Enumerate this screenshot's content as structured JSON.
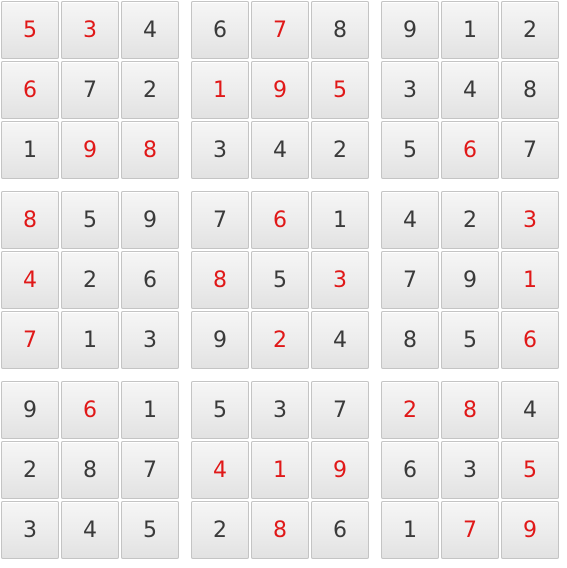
{
  "colors": {
    "given_digit": "#e01818",
    "entered_digit": "#3a3a3a",
    "cell_background": "#ececec",
    "cell_border": "#c4c4c4"
  },
  "board": {
    "grid": [
      [
        "5",
        "3",
        "4",
        "6",
        "7",
        "8",
        "9",
        "1",
        "2"
      ],
      [
        "6",
        "7",
        "2",
        "1",
        "9",
        "5",
        "3",
        "4",
        "8"
      ],
      [
        "1",
        "9",
        "8",
        "3",
        "4",
        "2",
        "5",
        "6",
        "7"
      ],
      [
        "8",
        "5",
        "9",
        "7",
        "6",
        "1",
        "4",
        "2",
        "3"
      ],
      [
        "4",
        "2",
        "6",
        "8",
        "5",
        "3",
        "7",
        "9",
        "1"
      ],
      [
        "7",
        "1",
        "3",
        "9",
        "2",
        "4",
        "8",
        "5",
        "6"
      ],
      [
        "9",
        "6",
        "1",
        "5",
        "3",
        "7",
        "2",
        "8",
        "4"
      ],
      [
        "2",
        "8",
        "7",
        "4",
        "1",
        "9",
        "6",
        "3",
        "5"
      ],
      [
        "3",
        "4",
        "5",
        "2",
        "8",
        "6",
        "1",
        "7",
        "9"
      ]
    ],
    "given": [
      [
        1,
        1,
        0,
        0,
        1,
        0,
        0,
        0,
        0
      ],
      [
        1,
        0,
        0,
        1,
        1,
        1,
        0,
        0,
        0
      ],
      [
        0,
        1,
        1,
        0,
        0,
        0,
        0,
        1,
        0
      ],
      [
        1,
        0,
        0,
        0,
        1,
        0,
        0,
        0,
        1
      ],
      [
        1,
        0,
        0,
        1,
        0,
        1,
        0,
        0,
        1
      ],
      [
        1,
        0,
        0,
        0,
        1,
        0,
        0,
        0,
        1
      ],
      [
        0,
        1,
        0,
        0,
        0,
        0,
        1,
        1,
        0
      ],
      [
        0,
        0,
        0,
        1,
        1,
        1,
        0,
        0,
        1
      ],
      [
        0,
        0,
        0,
        0,
        1,
        0,
        0,
        1,
        1
      ]
    ]
  }
}
